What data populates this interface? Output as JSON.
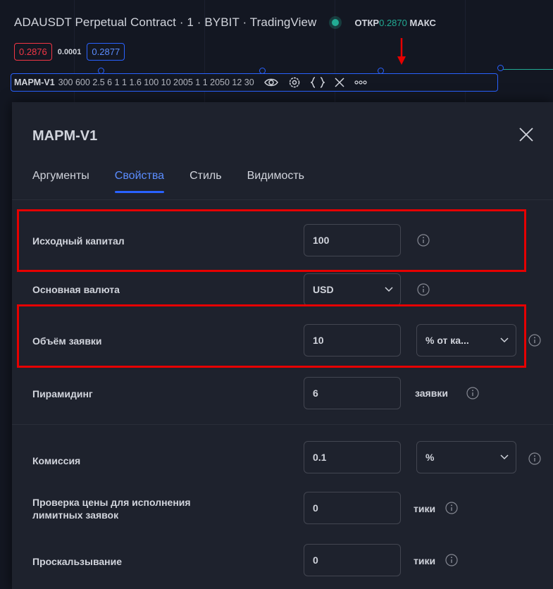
{
  "chart": {
    "title": "ADAUSDT Perpetual Contract · 1 · BYBIT · TradingView",
    "ohlc_label": "ОТКР",
    "ohlc_value": "0.2870",
    "ohlc_label2": "МАКС",
    "sell_price": "0.2876",
    "spread": "0.0001",
    "buy_price": "0.2877",
    "status_color": "#22ab94"
  },
  "indicator": {
    "name": "MAPM-V1",
    "params": "300 600 2.5 6 1 1 1.6 100 10 2005 1 1 2050 12 30",
    "icons": [
      "eye-icon",
      "gear-icon",
      "braces-icon",
      "close-icon",
      "more-icon"
    ]
  },
  "dialog": {
    "title": "MAPM-V1",
    "tabs": [
      {
        "label": "Аргументы",
        "active": false
      },
      {
        "label": "Свойства",
        "active": true
      },
      {
        "label": "Стиль",
        "active": false
      },
      {
        "label": "Видимость",
        "active": false
      }
    ],
    "fields": {
      "initial_capital": {
        "label": "Исходный капитал",
        "value": "100"
      },
      "base_currency": {
        "label": "Основная валюта",
        "value": "USD"
      },
      "order_size": {
        "label": "Объём заявки",
        "value": "10",
        "unit": "% от ка..."
      },
      "pyramiding": {
        "label": "Пирамидинг",
        "value": "6",
        "unit": "заявки"
      },
      "commission": {
        "label": "Комиссия",
        "value": "0.1",
        "unit": "%"
      },
      "limit_verify": {
        "label_line1": "Проверка цены для исполнения",
        "label_line2": "лимитных заявок",
        "value": "0",
        "unit": "тики"
      },
      "slippage": {
        "label": "Проскальзывание",
        "value": "0",
        "unit": "тики"
      }
    }
  },
  "colors": {
    "accent": "#2962ff",
    "annotation_red": "#e60000",
    "sell_red": "#f23645",
    "green": "#22ab94"
  }
}
